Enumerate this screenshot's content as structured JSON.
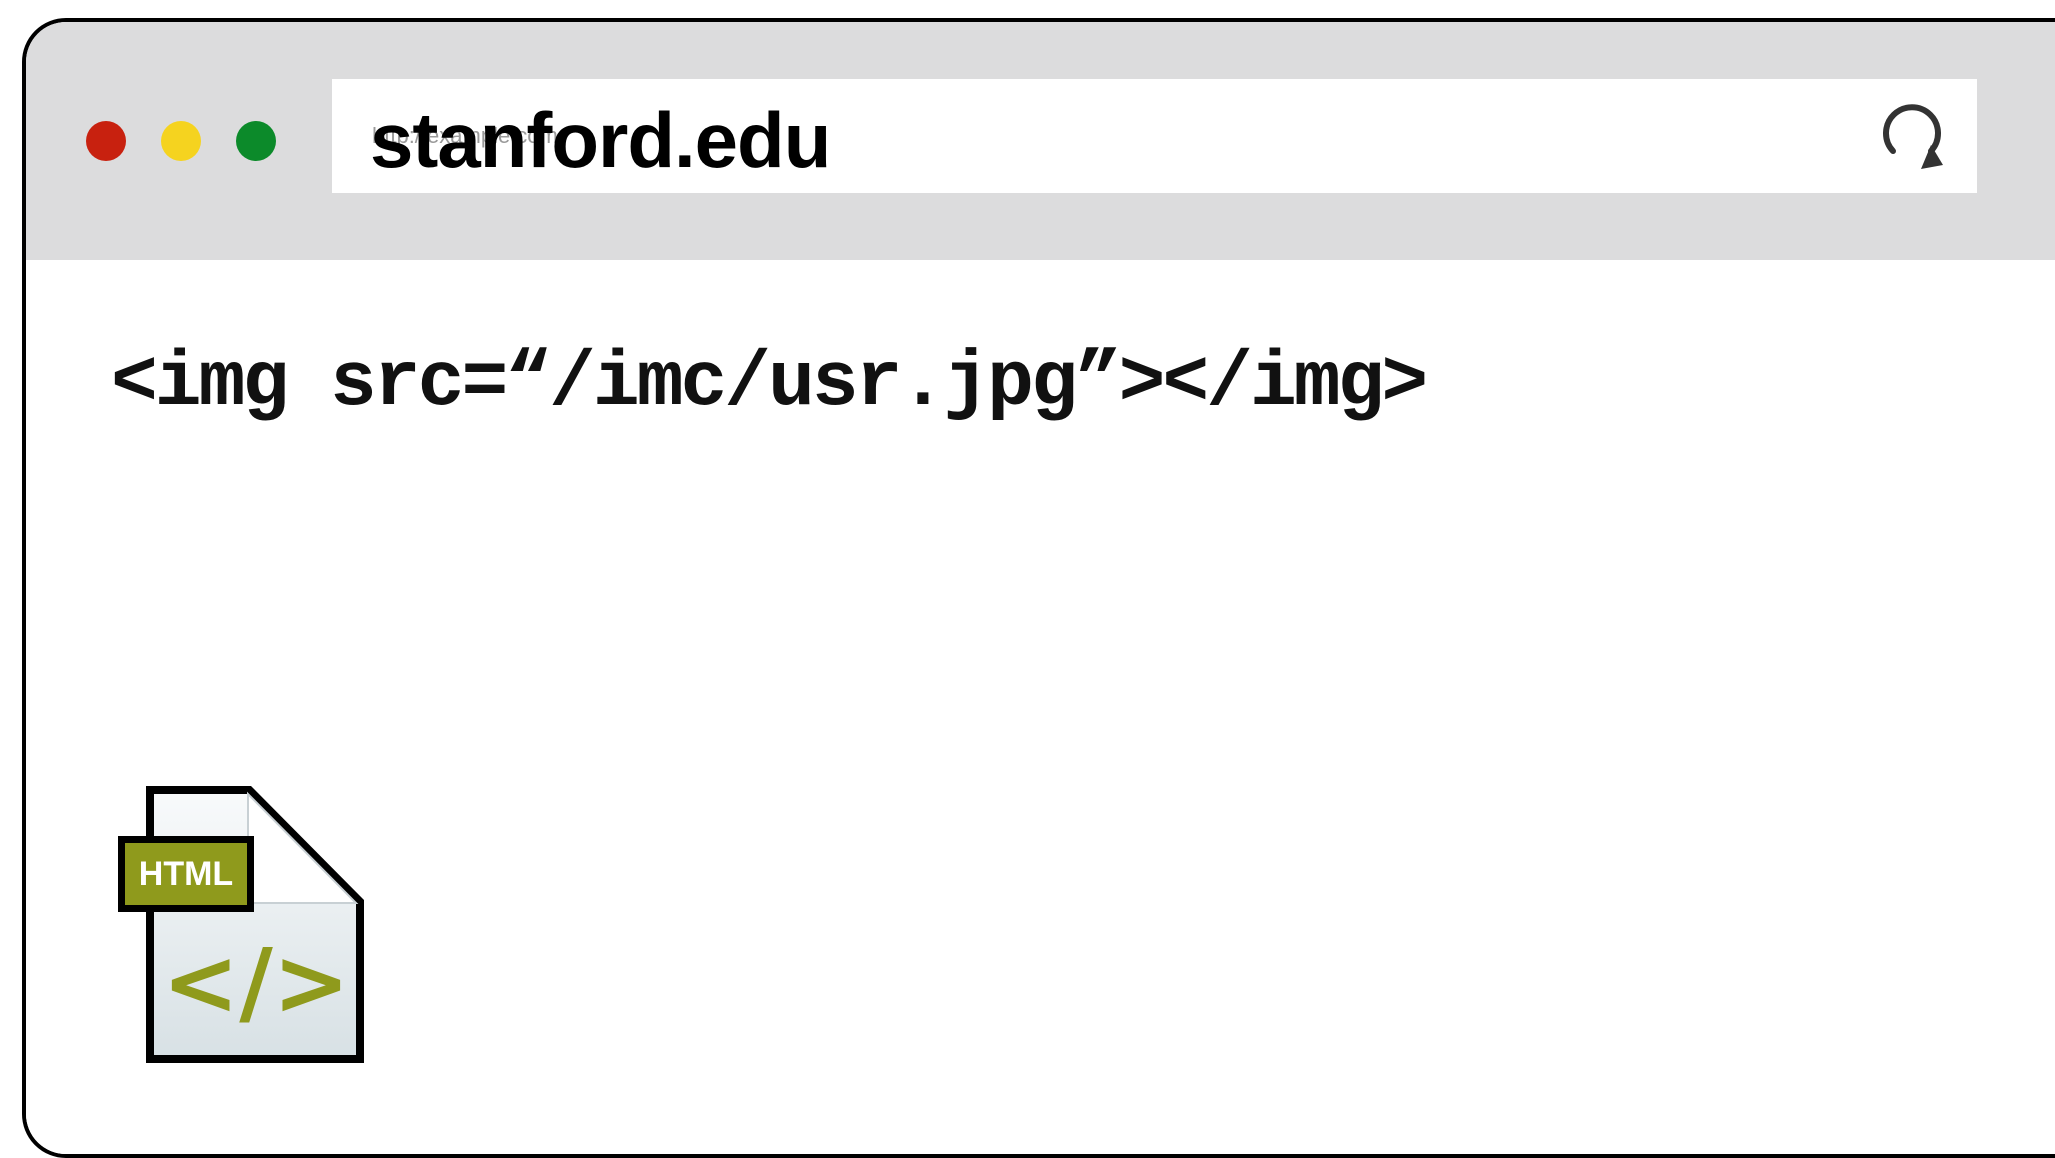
{
  "browser": {
    "address_bar": {
      "placeholder": "http://example.com",
      "domain": "stanford.edu"
    },
    "traffic_lights": {
      "close_color": "#c8210f",
      "minimize_color": "#f5d31f",
      "maximize_color": "#0c8a2a"
    },
    "icons": {
      "reload": "reload-icon"
    }
  },
  "content": {
    "code_text": "<img src=“/imc/usr.jpg”></img>",
    "file_icon": {
      "badge": "HTML",
      "symbol": "</>",
      "accent_color": "#8f9a1c"
    }
  }
}
